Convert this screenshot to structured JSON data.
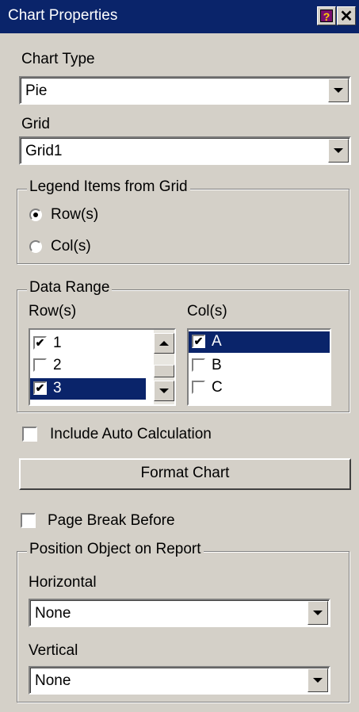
{
  "window": {
    "title": "Chart Properties",
    "help_icon": "help-icon",
    "close_glyph": "✕"
  },
  "chart_type": {
    "label": "Chart Type",
    "value": "Pie"
  },
  "grid": {
    "label": "Grid",
    "value": "Grid1"
  },
  "legend_group": {
    "title": "Legend Items from Grid",
    "options": [
      {
        "label": "Row(s)",
        "selected": true
      },
      {
        "label": "Col(s)",
        "selected": false
      }
    ]
  },
  "data_range": {
    "title": "Data Range",
    "rows_label": "Row(s)",
    "cols_label": "Col(s)",
    "rows": [
      {
        "label": "1",
        "checked": true
      },
      {
        "label": "2",
        "checked": false
      },
      {
        "label": "3",
        "checked": true,
        "selected": true
      }
    ],
    "cols": [
      {
        "label": "A",
        "checked": true,
        "selected": true
      },
      {
        "label": "B",
        "checked": false
      },
      {
        "label": "C",
        "checked": false
      }
    ]
  },
  "include_auto_calc": {
    "label": "Include Auto Calculation",
    "checked": false
  },
  "format_chart_button": "Format Chart",
  "page_break_before": {
    "label": "Page Break Before",
    "checked": false
  },
  "position_group": {
    "title": "Position Object on Report",
    "horizontal_label": "Horizontal",
    "horizontal_value": "None",
    "vertical_label": "Vertical",
    "vertical_value": "None"
  },
  "check_glyph": "✔"
}
